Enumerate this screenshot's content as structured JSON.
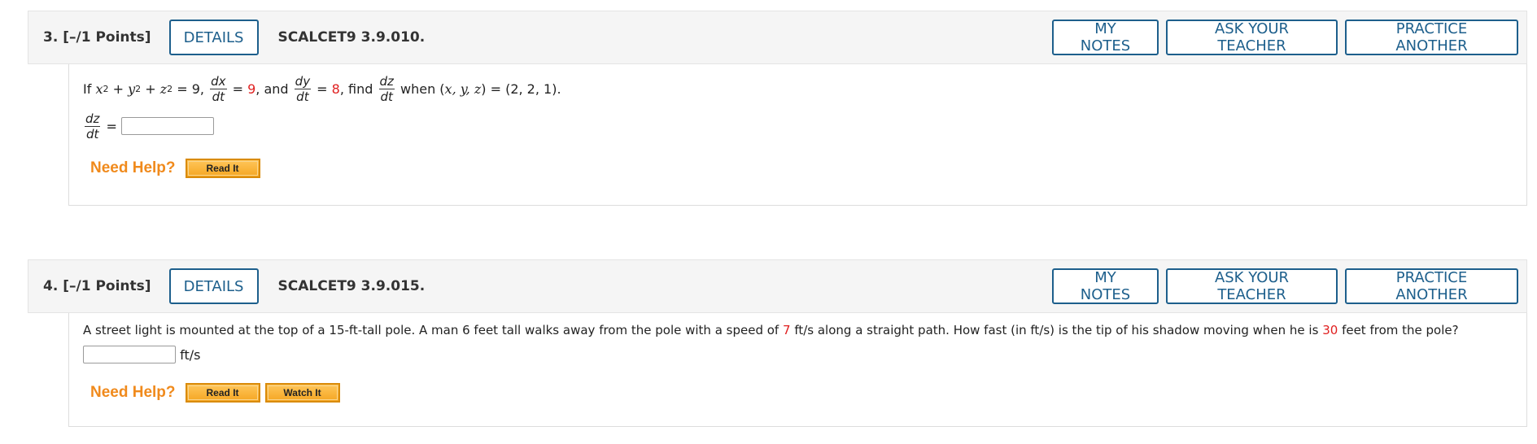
{
  "questions": [
    {
      "number": "3.",
      "points": "[–/1 Points]",
      "details_label": "DETAILS",
      "code": "SCALCET9 3.9.010.",
      "my_notes_label": "MY NOTES",
      "ask_teacher_label": "ASK YOUR TEACHER",
      "practice_label": "PRACTICE ANOTHER",
      "prompt": {
        "if": "If",
        "x": "x",
        "y": "y",
        "z": "z",
        "sq": "2",
        "plus": "+",
        "equation_end": "= 9,",
        "dx": "dx",
        "dt": "dt",
        "eq": "=",
        "dxdt_value": "9",
        "and": ", and",
        "dy": "dy",
        "dydt_value": "8",
        "find": ", find",
        "dz": "dz",
        "when": "when (",
        "vars": "x, y, z",
        "point": ") = (2, 2, 1)."
      },
      "answer_label_num": "dz",
      "answer_label_den": "dt",
      "answer_eq": "=",
      "answer_value": "",
      "need_help": "Need Help?",
      "help_buttons": [
        "Read It"
      ]
    },
    {
      "number": "4.",
      "points": "[–/1 Points]",
      "details_label": "DETAILS",
      "code": "SCALCET9 3.9.015.",
      "my_notes_label": "MY NOTES",
      "ask_teacher_label": "ASK YOUR TEACHER",
      "practice_label": "PRACTICE ANOTHER",
      "prompt": {
        "part1": "A street light is mounted at the top of a 15-ft-tall pole. A man 6 feet tall walks away from the pole with a speed of",
        "speed": "7",
        "part2": "ft/s along a straight path. How fast (in ft/s) is the tip of his shadow moving when he is",
        "distance": "30",
        "part3": "feet from the pole?"
      },
      "answer_value": "",
      "answer_unit": "ft/s",
      "need_help": "Need Help?",
      "help_buttons": [
        "Read It",
        "Watch It"
      ]
    }
  ],
  "colors": {
    "button_blue": "#1d5f8c",
    "need_help_orange": "#f08a1c",
    "highlight_red": "#e02020"
  }
}
